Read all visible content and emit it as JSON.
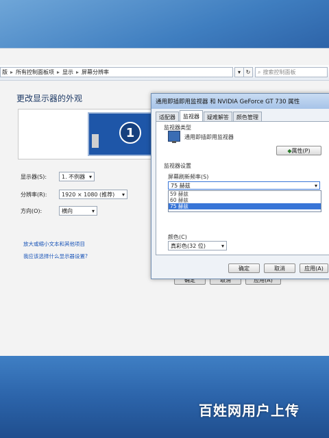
{
  "breadcrumb": {
    "items": [
      "版",
      "所有控制面板项",
      "显示",
      "屏幕分辨率"
    ],
    "refresh_icon": "refresh-icon",
    "search_placeholder": "搜索控制面板"
  },
  "main": {
    "title": "更改显示器的外观",
    "monitor_number": "1",
    "display_label": "显示器(S):",
    "display_value": "1. 不例器",
    "resolution_label": "分辨率(R):",
    "resolution_value": "1920 × 1080 (推荐)",
    "orientation_label": "方向(O):",
    "orientation_value": "横向",
    "link_text_size": "放大或缩小文本和其他项目",
    "link_settings": "我应该选择什么显示器设置?",
    "buttons": {
      "ok": "确定",
      "cancel": "取消",
      "apply": "应用(A)"
    }
  },
  "dialog": {
    "title": "通用即插即用监视器 和 NVIDIA GeForce GT 730 属性",
    "tabs": [
      "适配器",
      "监视器",
      "疑难解答",
      "颜色管理"
    ],
    "active_tab": 1,
    "monitor_type_label": "监视器类型",
    "monitor_name": "通用即插即用监视器",
    "properties_button": "属性(P)",
    "settings_label": "监视器设置",
    "refresh_label": "屏幕刷新频率(S)",
    "refresh_selected": "75 赫兹",
    "refresh_options": [
      "59 赫兹",
      "60 赫兹",
      "75 赫兹"
    ],
    "colors_label": "颜色(C)",
    "colors_value": "真彩色(32 位)",
    "buttons": {
      "ok": "确定",
      "cancel": "取消",
      "apply": "应用(A)"
    }
  },
  "watermark": "百姓网用户上传"
}
